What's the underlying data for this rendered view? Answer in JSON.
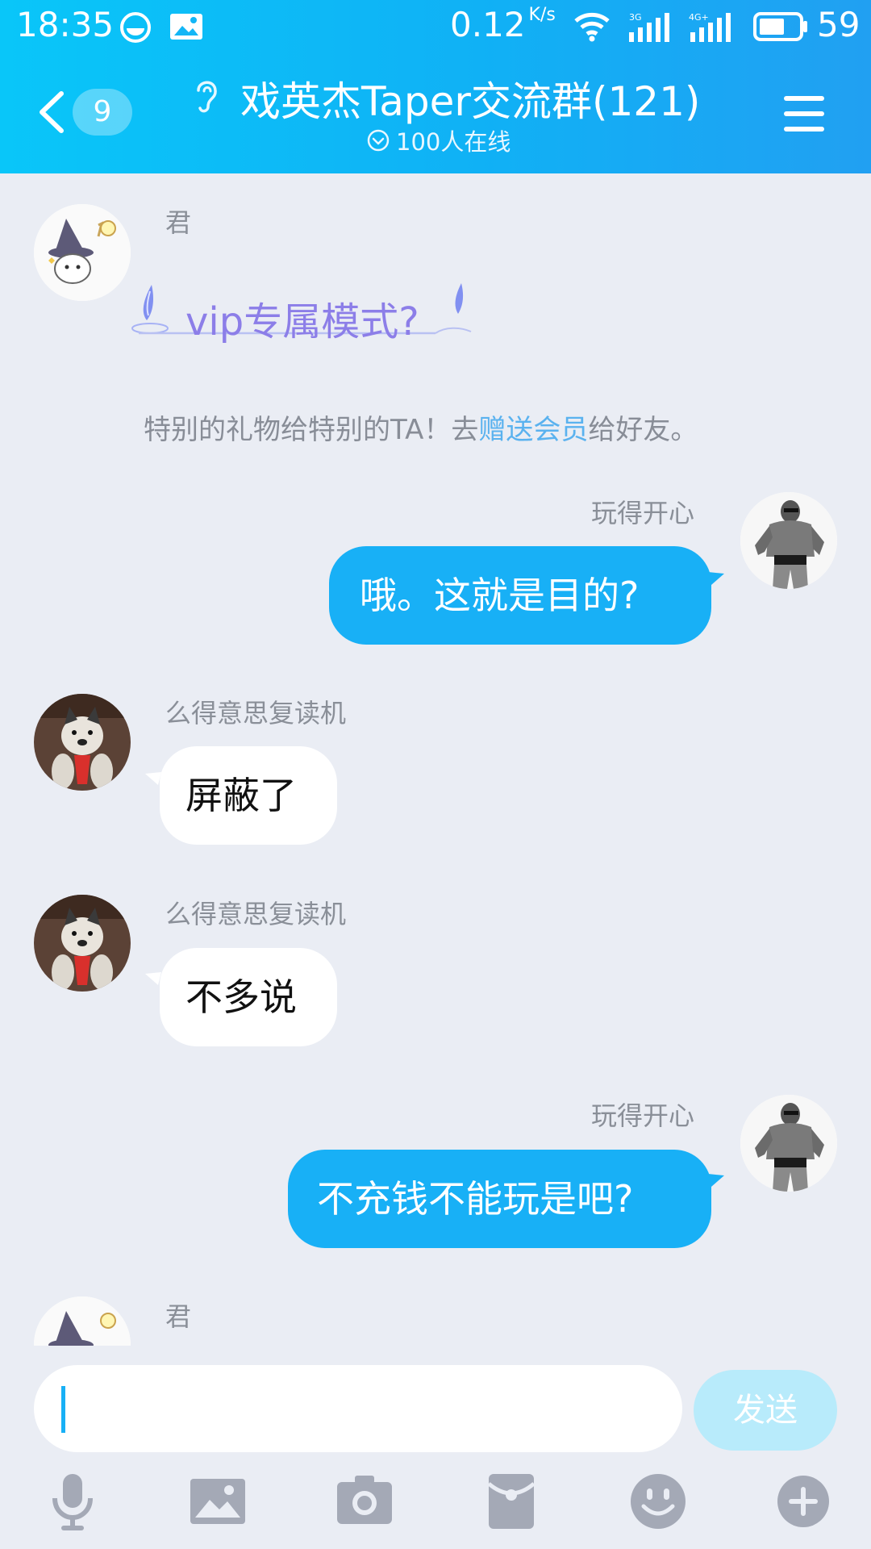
{
  "status_bar": {
    "time": "18:35",
    "net_speed": "0.12",
    "net_speed_unit": "K/s",
    "battery_level": "59"
  },
  "header": {
    "unread_count": "9",
    "title": "戏英杰Taper交流群(121)",
    "online_text": "100人在线"
  },
  "messages": [
    {
      "sender": "君",
      "side": "in",
      "type": "vip_sticker",
      "text": "vip专属模式?"
    },
    {
      "type": "system_tip",
      "text_before": "特别的礼物给特别的TA！去",
      "link_text": "赠送会员",
      "text_after": "给好友。"
    },
    {
      "sender": "玩得开心",
      "side": "out",
      "text": "哦。这就是目的?"
    },
    {
      "sender": "么得意思复读机",
      "side": "in",
      "text": "屏蔽了"
    },
    {
      "sender": "么得意思复读机",
      "side": "in",
      "text": "不多说"
    },
    {
      "sender": "玩得开心",
      "side": "out",
      "text": "不充钱不能玩是吧?"
    },
    {
      "sender": "君",
      "side": "in",
      "text": ""
    }
  ],
  "input": {
    "placeholder": "",
    "send_label": "发送"
  },
  "toolbar": [
    "microphone-icon",
    "image-icon",
    "camera-icon",
    "red-packet-icon",
    "emoji-icon",
    "plus-icon"
  ],
  "colors": {
    "header_start": "#09c6f9",
    "header_end": "#21a0f2",
    "out_bubble": "#18b0f6",
    "chat_bg": "#eaedf4",
    "send_disabled": "#b8ebfb"
  }
}
